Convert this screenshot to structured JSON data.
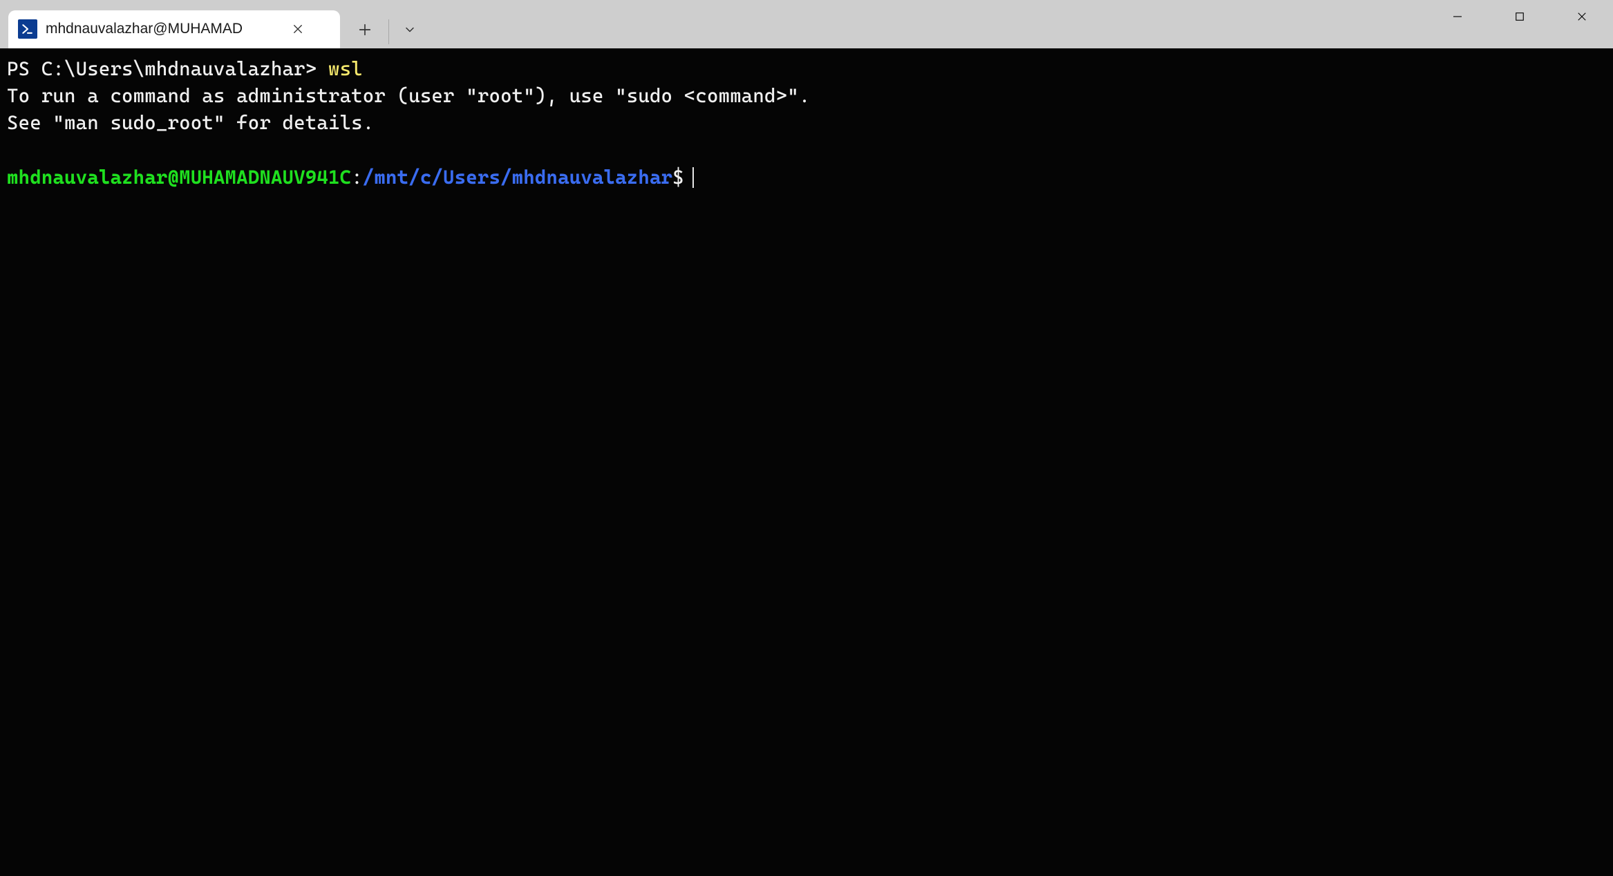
{
  "titlebar": {
    "tab_title": "mhdnauvalazhar@MUHAMAD"
  },
  "terminal": {
    "ps_prompt": "PS C:\\Users\\mhdnauvalazhar> ",
    "ps_command": "wsl",
    "line1": "To run a command as administrator (user \"root\"), use \"sudo <command>\".",
    "line2": "See \"man sudo_root\" for details.",
    "wsl_userhost": "mhdnauvalazhar@MUHAMADNAUV941C",
    "wsl_colon": ":",
    "wsl_path": "/mnt/c/Users/mhdnauvalazhar",
    "wsl_dollar": "$"
  }
}
